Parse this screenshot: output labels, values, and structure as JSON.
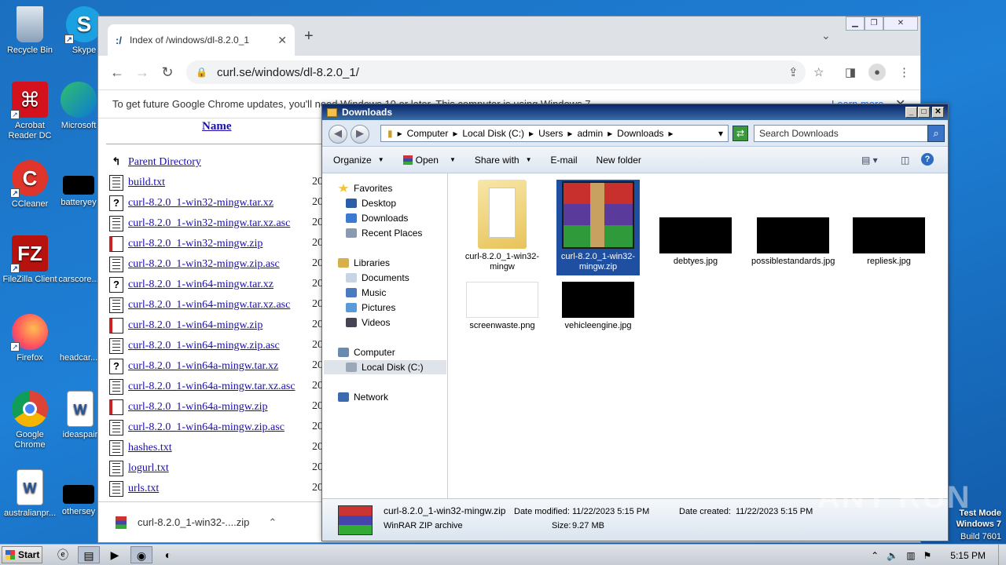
{
  "desktop": {
    "icons": [
      {
        "label": "Recycle Bin"
      },
      {
        "label": "Skype"
      },
      {
        "label": "Acrobat Reader DC"
      },
      {
        "label": "Microsoft"
      },
      {
        "label": "CCleaner"
      },
      {
        "label": "batteryey"
      },
      {
        "label": "FileZilla Client"
      },
      {
        "label": "carscore..."
      },
      {
        "label": "Firefox"
      },
      {
        "label": "headcar..."
      },
      {
        "label": "Google Chrome"
      },
      {
        "label": "ideaspair"
      },
      {
        "label": "australianpr..."
      },
      {
        "label": "othersey"
      }
    ]
  },
  "chrome": {
    "tab_title": "Index of /windows/dl-8.2.0_1",
    "url": "curl.se/windows/dl-8.2.0_1/",
    "infobar_text": "To get future Google Chrome updates, you'll need Windows 10 or later. This computer is using Windows 7.",
    "infobar_link": "Learn more",
    "listing": {
      "header_name": "Name",
      "files": [
        {
          "name": "Parent Directory",
          "type": "parent",
          "date": ""
        },
        {
          "name": "build.txt",
          "type": "txt",
          "date": "20"
        },
        {
          "name": "curl-8.2.0_1-win32-mingw.tar.xz",
          "type": "unknown",
          "date": "20"
        },
        {
          "name": "curl-8.2.0_1-win32-mingw.tar.xz.asc",
          "type": "txt",
          "date": "20"
        },
        {
          "name": "curl-8.2.0_1-win32-mingw.zip",
          "type": "zip",
          "date": "20"
        },
        {
          "name": "curl-8.2.0_1-win32-mingw.zip.asc",
          "type": "txt",
          "date": "20"
        },
        {
          "name": "curl-8.2.0_1-win64-mingw.tar.xz",
          "type": "unknown",
          "date": "20"
        },
        {
          "name": "curl-8.2.0_1-win64-mingw.tar.xz.asc",
          "type": "txt",
          "date": "20"
        },
        {
          "name": "curl-8.2.0_1-win64-mingw.zip",
          "type": "zip",
          "date": "20"
        },
        {
          "name": "curl-8.2.0_1-win64-mingw.zip.asc",
          "type": "txt",
          "date": "20"
        },
        {
          "name": "curl-8.2.0_1-win64a-mingw.tar.xz",
          "type": "unknown",
          "date": "20"
        },
        {
          "name": "curl-8.2.0_1-win64a-mingw.tar.xz.asc",
          "type": "txt",
          "date": "20"
        },
        {
          "name": "curl-8.2.0_1-win64a-mingw.zip",
          "type": "zip",
          "date": "20"
        },
        {
          "name": "curl-8.2.0_1-win64a-mingw.zip.asc",
          "type": "txt",
          "date": "20"
        },
        {
          "name": "hashes.txt",
          "type": "txt",
          "date": "20"
        },
        {
          "name": "logurl.txt",
          "type": "txt",
          "date": "20"
        },
        {
          "name": "urls.txt",
          "type": "txt",
          "date": "20"
        }
      ]
    },
    "download_item": "curl-8.2.0_1-win32-....zip"
  },
  "explorer": {
    "title": "Downloads",
    "breadcrumb": [
      "Computer",
      "Local Disk (C:)",
      "Users",
      "admin",
      "Downloads"
    ],
    "search_placeholder": "Search Downloads",
    "commands": {
      "organize": "Organize",
      "open": "Open",
      "share": "Share with",
      "email": "E-mail",
      "new_folder": "New folder"
    },
    "nav": {
      "favorites": "Favorites",
      "desktop": "Desktop",
      "downloads": "Downloads",
      "recent": "Recent Places",
      "libraries": "Libraries",
      "documents": "Documents",
      "music": "Music",
      "pictures": "Pictures",
      "videos": "Videos",
      "computer": "Computer",
      "local_disk": "Local Disk (C:)",
      "network": "Network"
    },
    "items": [
      {
        "name": "curl-8.2.0_1-win32-mingw",
        "kind": "folder"
      },
      {
        "name": "curl-8.2.0_1-win32-mingw.zip",
        "kind": "zip"
      },
      {
        "name": "debtyes.jpg",
        "kind": "dark-image"
      },
      {
        "name": "possiblestandards.jpg",
        "kind": "dark-image"
      },
      {
        "name": "repliesk.jpg",
        "kind": "dark-image"
      },
      {
        "name": "screenwaste.png",
        "kind": "white-image"
      },
      {
        "name": "vehicleengine.jpg",
        "kind": "dark-image"
      }
    ],
    "details": {
      "filename": "curl-8.2.0_1-win32-mingw.zip",
      "filetype": "WinRAR ZIP archive",
      "modified_label": "Date modified:",
      "modified": "11/22/2023 5:15 PM",
      "size_label": "Size:",
      "size": "9.27 MB",
      "created_label": "Date created:",
      "created": "11/22/2023 5:15 PM"
    }
  },
  "taskbar": {
    "start": "Start",
    "clock": "5:15 PM"
  },
  "watermark": {
    "line1": "Test Mode",
    "line2": "Windows 7",
    "line3": "Build 7601",
    "brand": "ANY RUN"
  }
}
